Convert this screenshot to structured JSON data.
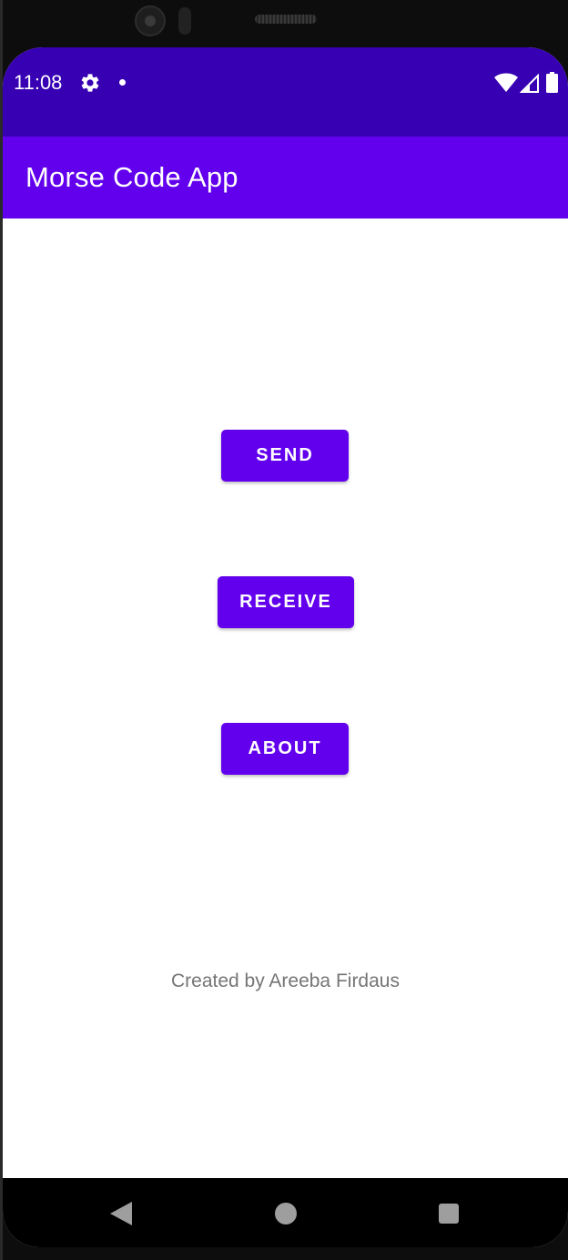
{
  "status_bar": {
    "time": "11:08",
    "icons": [
      "gear-icon",
      "notification-dot-icon",
      "wifi-icon",
      "cell-signal-icon",
      "battery-icon"
    ]
  },
  "app_bar": {
    "title": "Morse Code App"
  },
  "main": {
    "send_label": "SEND",
    "receive_label": "RECEIVE",
    "about_label": "ABOUT",
    "credit": "Created by Areeba Firdaus"
  },
  "nav_bar": {
    "icons": [
      "back-icon",
      "home-icon",
      "recents-icon"
    ]
  },
  "colors": {
    "status_bar": "#3700b3",
    "primary": "#6200ee",
    "credit_text": "#757575",
    "nav_bar": "#000000"
  }
}
